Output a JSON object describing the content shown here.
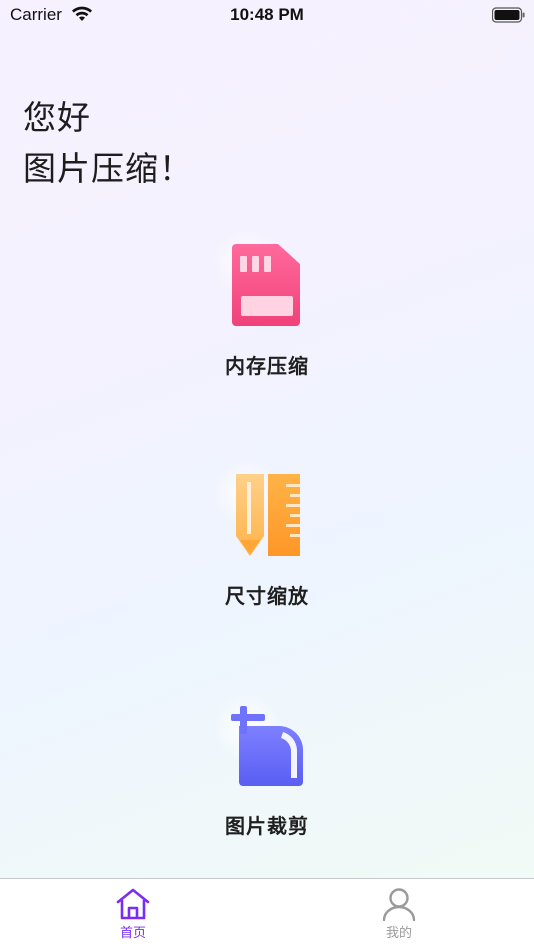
{
  "status_bar": {
    "carrier": "Carrier",
    "time": "10:48 PM"
  },
  "greeting": {
    "line1": "您好",
    "line2": "图片压缩！"
  },
  "features": [
    {
      "label": "内存压缩",
      "icon": "memory-card-icon"
    },
    {
      "label": "尺寸缩放",
      "icon": "pencil-ruler-icon"
    },
    {
      "label": "图片裁剪",
      "icon": "crop-icon"
    }
  ],
  "tab_bar": {
    "tabs": [
      {
        "label": "首页",
        "icon": "home-icon",
        "selected": true
      },
      {
        "label": "我的",
        "icon": "user-icon",
        "selected": false
      }
    ]
  },
  "colors": {
    "accent": "#7a2cf0",
    "tab_inactive": "#9a9a9a",
    "memory_card": "#f64b86",
    "pencil": "#ffb144",
    "ruler": "#ff9e2c",
    "crop": "#6b6ff7"
  }
}
